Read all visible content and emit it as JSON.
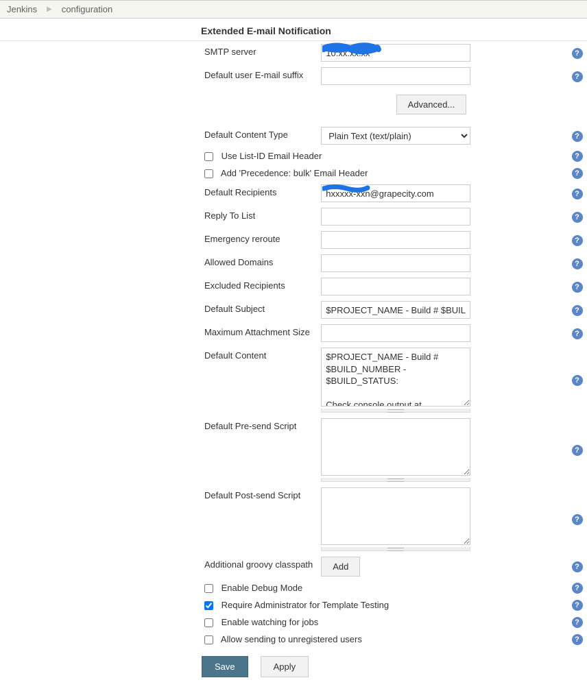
{
  "breadcrumb": {
    "root": "Jenkins",
    "page": "configuration"
  },
  "section_title": "Extended E-mail Notification",
  "labels": {
    "smtp_server": "SMTP server",
    "default_suffix": "Default user E-mail suffix",
    "advanced": "Advanced...",
    "default_content_type": "Default Content Type",
    "use_list_id": "Use List-ID Email Header",
    "add_precedence": "Add 'Precedence: bulk' Email Header",
    "default_recipients": "Default Recipients",
    "reply_to": "Reply To List",
    "emergency_reroute": "Emergency reroute",
    "allowed_domains": "Allowed Domains",
    "excluded_recipients": "Excluded Recipients",
    "default_subject": "Default Subject",
    "max_attach": "Maximum Attachment Size",
    "default_content": "Default Content",
    "pre_send": "Default Pre-send Script",
    "post_send": "Default Post-send Script",
    "groovy_cp": "Additional groovy classpath",
    "add": "Add",
    "enable_debug": "Enable Debug Mode",
    "require_admin": "Require Administrator for Template Testing",
    "enable_watching": "Enable watching for jobs",
    "allow_unreg": "Allow sending to unregistered users",
    "save": "Save",
    "apply": "Apply"
  },
  "values": {
    "smtp_server": "10.xx.xx.xx",
    "default_suffix": "",
    "content_type_selected": "Plain Text (text/plain)",
    "use_list_id": false,
    "add_precedence": false,
    "default_recipients": "hxxxxx-xxn@grapecity.com",
    "reply_to": "",
    "emergency_reroute": "",
    "allowed_domains": "",
    "excluded_recipients": "",
    "default_subject": "$PROJECT_NAME - Build # $BUILD_NUMBER - $BUILD_STATUS!",
    "max_attach": "",
    "default_content": "$PROJECT_NAME - Build # $BUILD_NUMBER - $BUILD_STATUS:\n\nCheck console output at $BUILD_URL to view the results.",
    "pre_send": "",
    "post_send": "",
    "enable_debug": false,
    "require_admin": true,
    "enable_watching": false,
    "allow_unreg": false
  }
}
